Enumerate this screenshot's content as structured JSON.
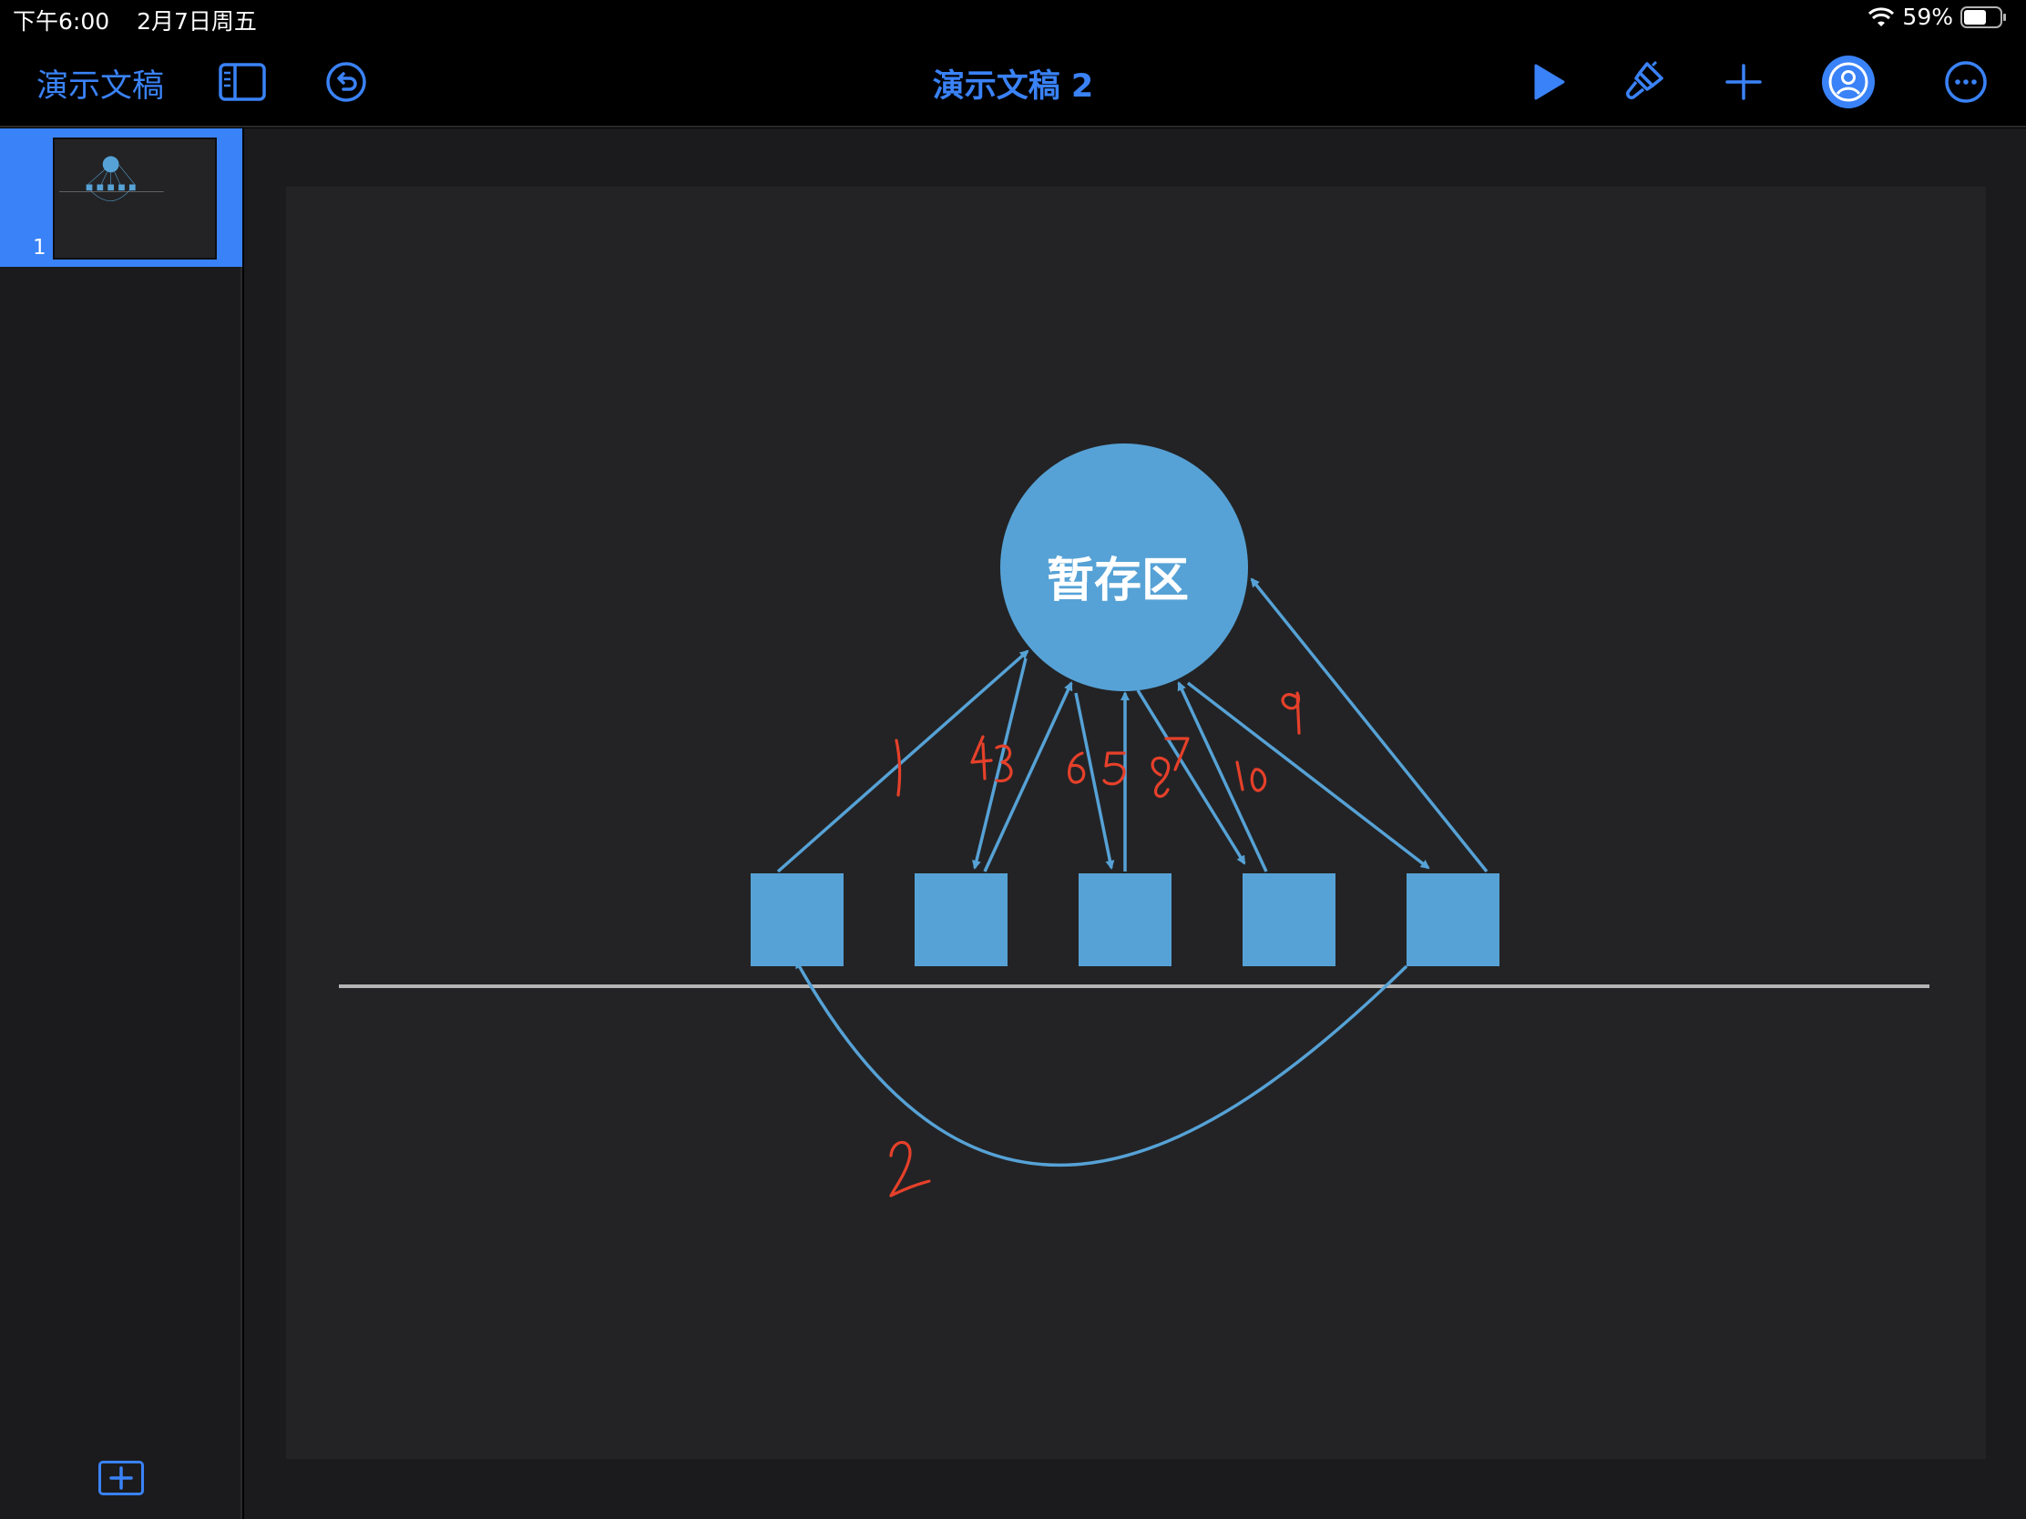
{
  "status": {
    "time": "下午6:00",
    "date": "2月7日周五",
    "battery": "59%"
  },
  "toolbar": {
    "back_label": "演示文稿",
    "title": "演示文稿 2",
    "icons": [
      "sidebar-icon",
      "undo-icon",
      "play-icon",
      "paintbrush-icon",
      "plus-icon",
      "collaborate-icon",
      "more-icon"
    ]
  },
  "navigator": {
    "slides": [
      {
        "number": "1"
      }
    ]
  },
  "slide": {
    "circle_label": "暂存区",
    "annotations": [
      "1",
      "2",
      "4",
      "3",
      "6",
      "5",
      "8",
      "7",
      "10",
      "9"
    ]
  },
  "colors": {
    "accent": "#3a82f7",
    "shape": "#56a2d6",
    "annotation": "#e6402a",
    "slide_bg": "#232325"
  }
}
